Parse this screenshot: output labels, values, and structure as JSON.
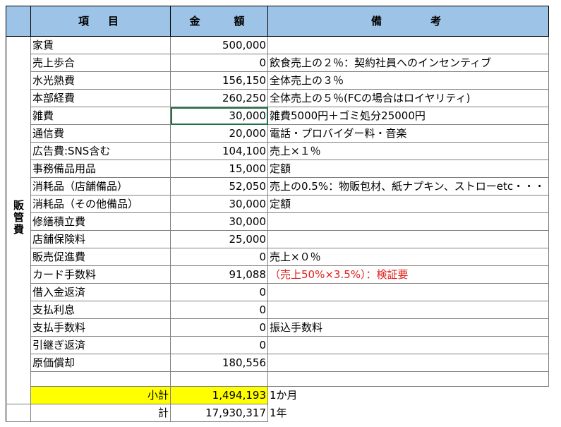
{
  "headers": {
    "item": "項　目",
    "amount": "金　　額",
    "note": "備　　　考"
  },
  "category": "販管費",
  "rows": [
    {
      "item": "家賃",
      "amount": "500,000",
      "note": ""
    },
    {
      "item": "売上歩合",
      "amount": "0",
      "note": "飲食売上の２％：契約社員へのインセンティブ"
    },
    {
      "item": "水光熱費",
      "amount": "156,150",
      "note": "全体売上の３％"
    },
    {
      "item": "本部経費",
      "amount": "260,250",
      "note": "全体売上の５％(FCの場合はロイヤリティ)"
    },
    {
      "item": "雑費",
      "amount": "30,000",
      "note": "雑費5000円＋ゴミ処分25000円"
    },
    {
      "item": "通信費",
      "amount": "20,000",
      "note": "電話・プロバイダー料・音楽"
    },
    {
      "item": "広告費:SNS含む",
      "amount": "104,100",
      "note": "売上×１％"
    },
    {
      "item": "事務備品用品",
      "amount": "15,000",
      "note": "定額"
    },
    {
      "item": "消耗品（店舗備品）",
      "amount": "52,050",
      "note": "売上の0.5%：物販包材、紙ナプキン、ストローetc・・・"
    },
    {
      "item": "消耗品（その他備品）",
      "amount": "30,000",
      "note": "定額"
    },
    {
      "item": "修繕積立費",
      "amount": "30,000",
      "note": ""
    },
    {
      "item": "店舗保険料",
      "amount": "25,000",
      "note": ""
    },
    {
      "item": "販売促進費",
      "amount": "0",
      "note": "売上×０％"
    },
    {
      "item": "カード手数料",
      "amount": "91,088",
      "note": "（売上50%×3.5%）：検証要"
    },
    {
      "item": "借入金返済",
      "amount": "0",
      "note": ""
    },
    {
      "item": "支払利息",
      "amount": "0",
      "note": ""
    },
    {
      "item": "支払手数料",
      "amount": "0",
      "note": "振込手数料"
    },
    {
      "item": "引継ぎ返済",
      "amount": "0",
      "note": ""
    },
    {
      "item": "原価償却",
      "amount": "180,556",
      "note": ""
    }
  ],
  "subtotal": {
    "label": "小計",
    "amount": "1,494,193",
    "note": "1か月"
  },
  "total": {
    "label": "計",
    "amount": "17,930,317",
    "note": "1年"
  },
  "colors": {
    "header": "#9dc3e6",
    "highlight": "#ffff00",
    "warning": "#e0201b",
    "selection": "#217346"
  }
}
